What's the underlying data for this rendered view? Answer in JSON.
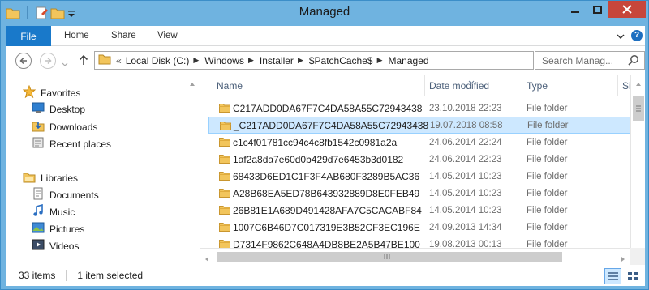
{
  "window": {
    "title": "Managed"
  },
  "ribbon": {
    "tabs": [
      {
        "label": "File"
      },
      {
        "label": "Home"
      },
      {
        "label": "Share"
      },
      {
        "label": "View"
      }
    ],
    "help_label": "?"
  },
  "address": {
    "overflow": "«",
    "crumbs": [
      "Local Disk (C:)",
      "Windows",
      "Installer",
      "$PatchCache$",
      "Managed"
    ],
    "search_placeholder": "Search Manag..."
  },
  "nav": {
    "favorites": {
      "label": "Favorites",
      "items": [
        "Desktop",
        "Downloads",
        "Recent places"
      ]
    },
    "libraries": {
      "label": "Libraries",
      "items": [
        "Documents",
        "Music",
        "Pictures",
        "Videos"
      ]
    }
  },
  "columns": {
    "name": "Name",
    "date": "Date modified",
    "type": "Type",
    "size": "Size"
  },
  "files": [
    {
      "name": "C217ADD0DA67F7C4DA58A55C72943438",
      "date": "23.10.2018 22:23",
      "type": "File folder"
    },
    {
      "name": "_C217ADD0DA67F7C4DA58A55C72943438",
      "date": "19.07.2018 08:58",
      "type": "File folder",
      "selected": true
    },
    {
      "name": "c1c4f01781cc94c4c8fb1542c0981a2a",
      "date": "24.06.2014 22:24",
      "type": "File folder"
    },
    {
      "name": "1af2a8da7e60d0b429d7e6453b3d0182",
      "date": "24.06.2014 22:23",
      "type": "File folder"
    },
    {
      "name": "68433D6ED1C1F3F4AB680F3289B5AC36",
      "date": "14.05.2014 10:23",
      "type": "File folder"
    },
    {
      "name": "A28B68EA5ED78B643932889D8E0FEB49",
      "date": "14.05.2014 10:23",
      "type": "File folder"
    },
    {
      "name": "26B81E1A689D491428AFA7C5CACABF84",
      "date": "14.05.2014 10:23",
      "type": "File folder"
    },
    {
      "name": "1007C6B46D7C017319E3B52CF3EC196E",
      "date": "24.09.2013 14:34",
      "type": "File folder"
    },
    {
      "name": "D7314F9862C648A4DB8BE2A5B47BE100",
      "date": "19.08.2013 00:13",
      "type": "File folder"
    }
  ],
  "status": {
    "items": "33 items",
    "selected": "1 item selected"
  },
  "colors": {
    "titlebar": "#6fb3e0",
    "file_tab": "#1979ca",
    "close": "#c7463b",
    "selection": "#cde8ff",
    "folder": "#f2c55c"
  }
}
